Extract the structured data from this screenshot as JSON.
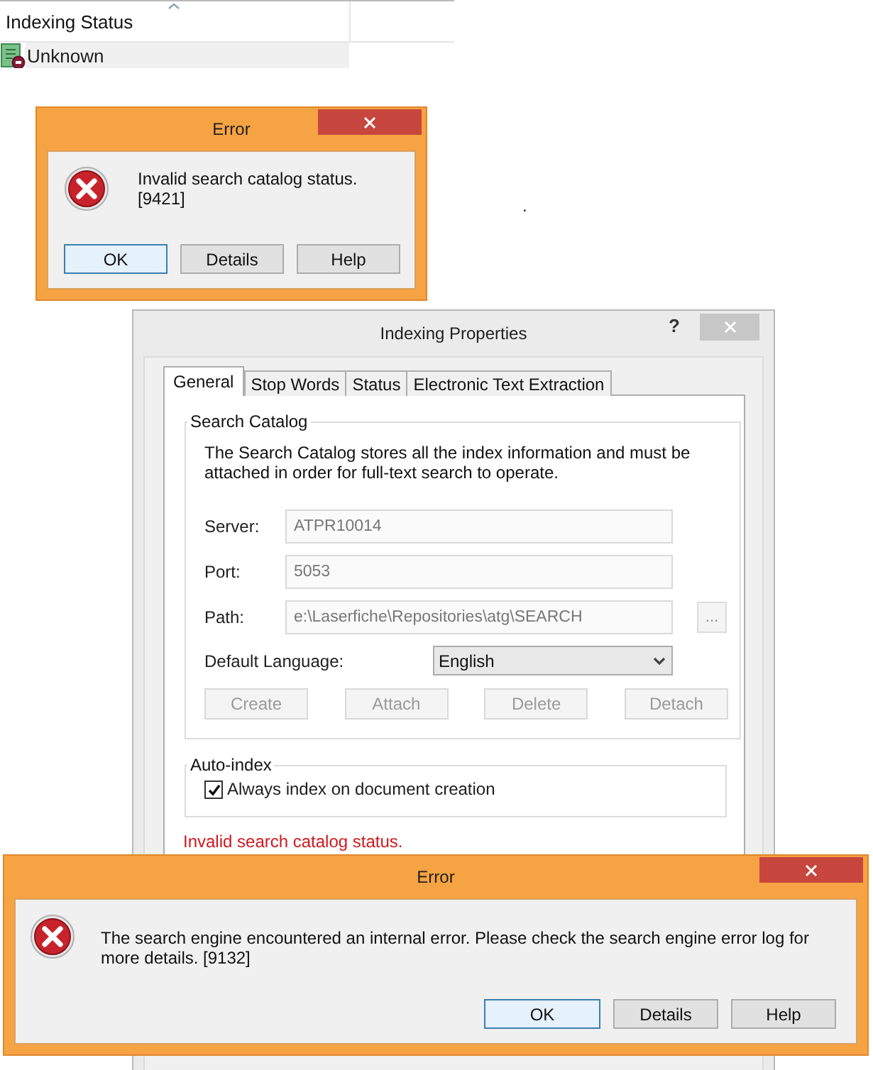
{
  "list": {
    "column": "Indexing Status",
    "sort_ascending": true,
    "rows": [
      {
        "status": "Unknown",
        "selected": false
      }
    ]
  },
  "error_dialogs": [
    {
      "title": "Error",
      "message": "Invalid search catalog status. [9421]",
      "buttons": [
        {
          "label": "OK",
          "default": true
        },
        {
          "label": "Details",
          "default": false
        },
        {
          "label": "Help",
          "default": false
        }
      ]
    },
    {
      "title": "Error",
      "message": "The search engine encountered an internal error. Please check the search engine error log for more details. [9132]",
      "buttons": [
        {
          "label": "OK",
          "default": true
        },
        {
          "label": "Details",
          "default": false
        },
        {
          "label": "Help",
          "default": false
        }
      ]
    }
  ],
  "stray_mark": ".",
  "properties": {
    "title": "Indexing Properties",
    "help": "?",
    "tabs": [
      {
        "label": "General",
        "selected": true
      },
      {
        "label": "Stop Words",
        "selected": false
      },
      {
        "label": "Status",
        "selected": false
      },
      {
        "label": "Electronic Text Extraction",
        "selected": false
      }
    ],
    "search_catalog": {
      "legend": "Search Catalog",
      "description": "The Search Catalog stores all the index information and must be attached in order for full-text search to operate.",
      "fields": [
        {
          "label": "Server:",
          "value": "ATPR10014"
        },
        {
          "label": "Port:",
          "value": "5053"
        },
        {
          "label": "Path:",
          "value": "e:\\Laserfiche\\Repositories\\atg\\SEARCH"
        }
      ],
      "browse_button": "...",
      "language_label": "Default Language:",
      "language": "English",
      "buttons": [
        {
          "label": "Create",
          "disabled": true
        },
        {
          "label": "Attach",
          "disabled": true
        },
        {
          "label": "Delete",
          "disabled": true
        },
        {
          "label": "Detach",
          "disabled": true
        }
      ]
    },
    "auto_index": {
      "legend": "Auto-index",
      "checkbox": {
        "label": "Always index on document creation",
        "checked": true
      }
    },
    "status_message": "Invalid search catalog status."
  }
}
